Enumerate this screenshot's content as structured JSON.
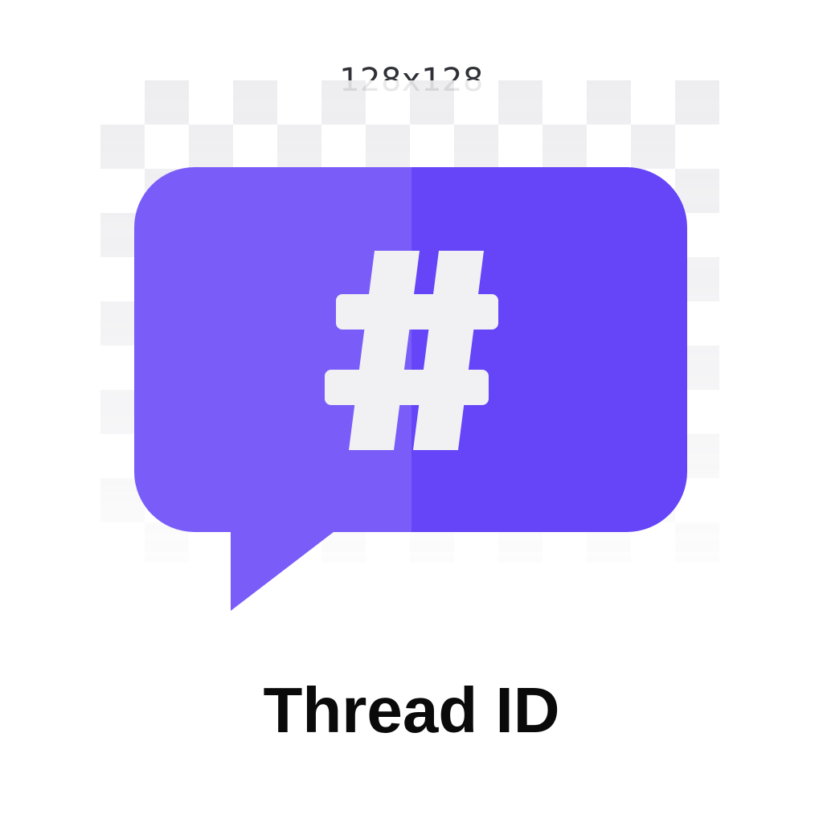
{
  "size_label": "128x128",
  "icon": {
    "name": "chat-bubble-hash-icon",
    "glyph": "hash",
    "color_left": "#7a5cf9",
    "color_right": "#6644f7",
    "glyph_color": "#f1f1f4"
  },
  "caption": "Thread ID"
}
